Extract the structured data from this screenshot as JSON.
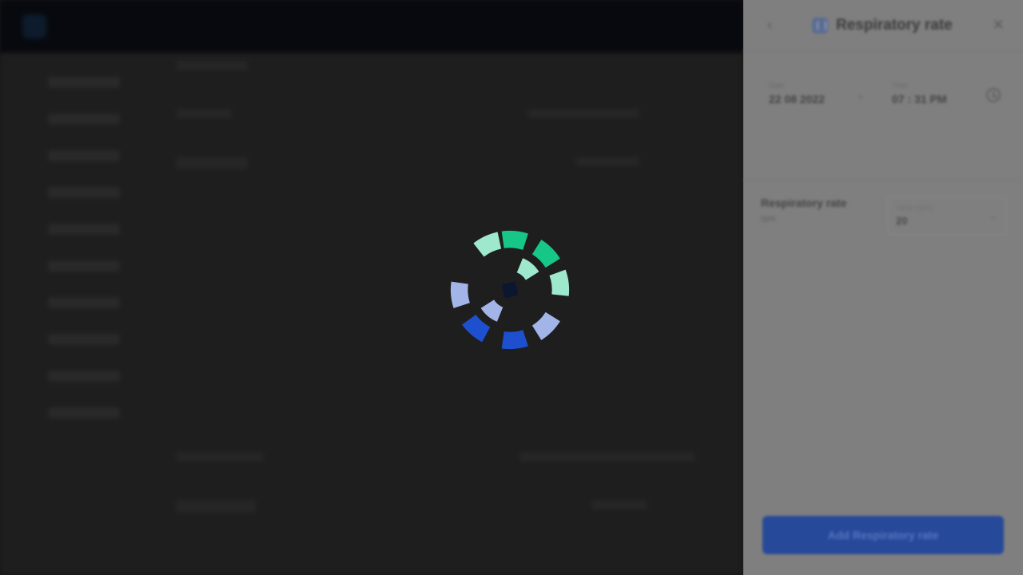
{
  "background_app": {
    "top_links": [
      "",
      "",
      ""
    ],
    "nav_items": 10
  },
  "panel": {
    "back_icon": "chevron-left-icon",
    "title_icon": "lungs-icon",
    "title": "Respiratory rate",
    "close_icon": "close-icon",
    "date": {
      "label": "Date",
      "value": "22 08 2022"
    },
    "time": {
      "label": "Time",
      "value": "07 : 31 PM"
    },
    "measure": {
      "name": "Respiratory rate",
      "unit": "rpm",
      "select_label": "Value (rpm)",
      "select_value": "20"
    },
    "add_button": "Add Respiratory rate"
  },
  "spinner": {
    "state": "loading",
    "colors": {
      "mint": "#9ee8cd",
      "green": "#16c787",
      "periwinkle": "#a3b5e8",
      "blue": "#1d4fce",
      "core": "#0b1630"
    }
  }
}
